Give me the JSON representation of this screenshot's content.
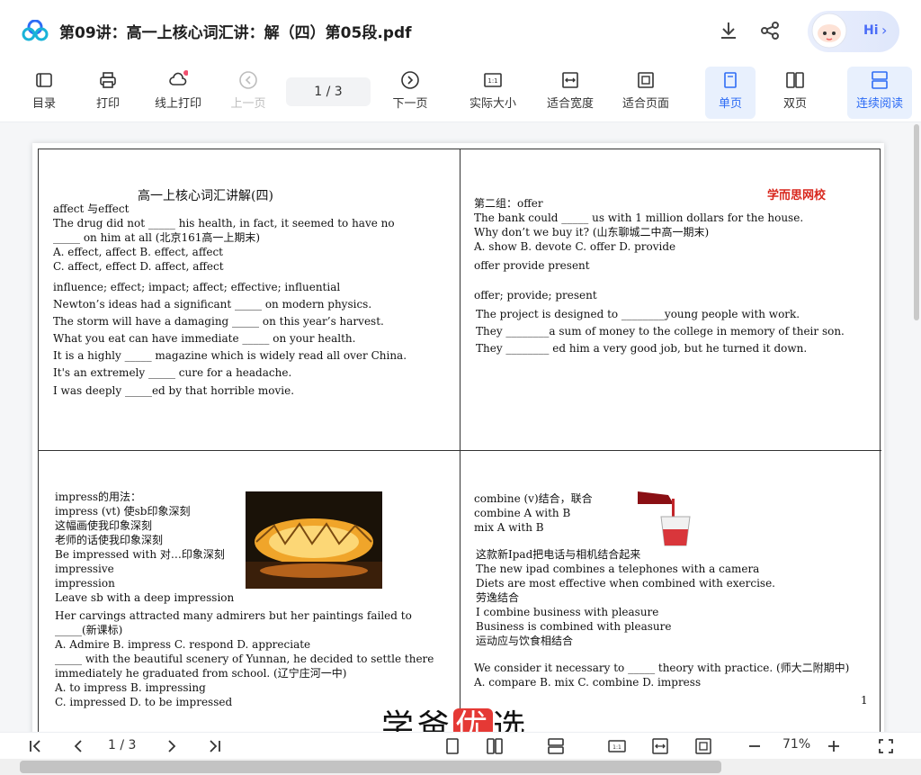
{
  "titlebar": {
    "title": "第09讲：高一上核心词汇讲：解（四）第05段.pdf",
    "hi_label": "Hi"
  },
  "toolbar": {
    "items": [
      {
        "label": "目录",
        "icon": "toc-icon"
      },
      {
        "label": "打印",
        "icon": "printer-icon"
      },
      {
        "label": "线上打印",
        "icon": "cloud-print-icon"
      },
      {
        "label": "上一页",
        "icon": "prev-page-icon"
      },
      {
        "label": "下一页",
        "icon": "next-page-icon"
      },
      {
        "label": "实际大小",
        "icon": "actual-size-icon"
      },
      {
        "label": "适合宽度",
        "icon": "fit-width-icon"
      },
      {
        "label": "适合页面",
        "icon": "fit-page-icon"
      },
      {
        "label": "单页",
        "icon": "single-page-icon"
      },
      {
        "label": "双页",
        "icon": "double-page-icon"
      },
      {
        "label": "连续阅读",
        "icon": "continuous-icon"
      }
    ],
    "page_indicator": "1  /  3"
  },
  "document": {
    "q1": {
      "title": "高一上核心词汇讲解(四)",
      "lines": [
        "affect 与effect",
        "The drug did not _____ his health, in fact, it seemed to have no",
        "_____ on him at all (北京161高一上期末)",
        "A. effect, affect           B. effect, affect",
        "C. affect, effect          D. affect, affect",
        "influence; effect; impact; affect; effective; influential",
        "Newton’s ideas had a significant _____ on modern physics.",
        "The storm will have a damaging _____ on this year’s harvest.",
        "What you eat can have immediate _____ on your health.",
        "It is a highly _____ magazine which is widely read all over China.",
        "It's an extremely _____ cure for a headache.",
        "I was deeply _____ed by that horrible movie."
      ]
    },
    "q2": {
      "brand": "学而思网校",
      "lines": [
        "第二组：offer",
        "The bank could _____ us with 1 million dollars for the house.",
        "Why don’t we buy it? (山东聊城二中高一期末)",
        "A. show       B. devote       C. offer        D. provide",
        "offer            provide          present",
        "offer; provide; present",
        "The project is designed to ________young people with work.",
        "They ________a sum of money to the college in memory of their son.",
        "They ________ ed him a very good job, but he turned it down."
      ]
    },
    "q3": {
      "lines": [
        "impress的用法：",
        "impress (vt) 使sb印象深刻",
        "这幅画使我印象深刻",
        "老师的话使我印象深刻",
        "Be impressed with 对…印象深刻",
        "impressive",
        "impression",
        "Leave sb with a deep impression",
        "Her carvings attracted many admirers but her paintings failed to",
        "_____(新课标)",
        "A. Admire                B. impress       C. respond       D. appreciate",
        "_____ with the beautiful scenery of Yunnan, he decided to settle there",
        "immediately he graduated from school. (辽宁庄河一中)",
        "A. to impress        B. impressing",
        "C. impressed        D. to be impressed"
      ]
    },
    "q4": {
      "lines": [
        "combine (v)结合，联合",
        "combine A with B",
        "mix A with B",
        "这款新Ipad把电话与相机结合起来",
        "The new ipad combines a telephones with a camera",
        "Diets are most effective when combined with exercise.",
        "劳逸结合",
        "I combine business with pleasure",
        "Business is combined with pleasure",
        "运动应与饮食相结合",
        "We consider it necessary to _____ theory with practice. (师大二附期中)",
        "A. compare                B. mix           C. combine              D. impress"
      ],
      "page_number": "1"
    }
  },
  "watermark": {
    "part1": "学爸",
    "part2": "优",
    "part3": "选"
  },
  "bottombar": {
    "page_indicator": "1  /  3",
    "zoom": "71%"
  }
}
